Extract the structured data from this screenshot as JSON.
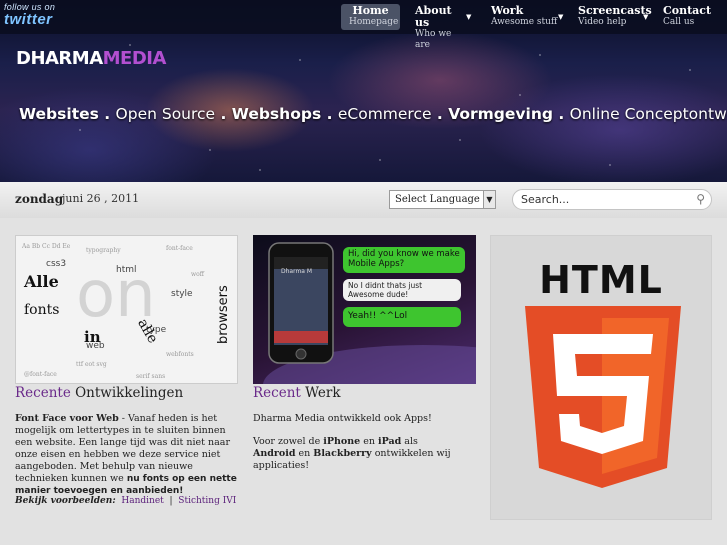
{
  "twitter": {
    "follow": "follow us on",
    "brand": "twitter"
  },
  "nav": [
    {
      "title": "Home",
      "sub": "Homepage"
    },
    {
      "title": "About us",
      "sub": "Who we are"
    },
    {
      "title": "Work",
      "sub": "Awesome stuff"
    },
    {
      "title": "Screencasts",
      "sub": "Video help"
    },
    {
      "title": "Contact",
      "sub": "Call us"
    }
  ],
  "logo": {
    "part1": "DHARMA",
    "part2": "MEDIA"
  },
  "tagline": {
    "w1": "Websites",
    "sep1": " . ",
    "w2": "Open Source",
    "sep2": " . ",
    "w3": "Webshops",
    "sep3": " . ",
    "w4": "eCommerce",
    "sep4": " . ",
    "w5": "Vormgeving",
    "sep5": " . ",
    "w6": "Online Conceptontwikkeling"
  },
  "datebar": {
    "day": "zondag",
    "date": "juni 26 , 2011"
  },
  "language": {
    "selected": "Select Language"
  },
  "search": {
    "placeholder": "Search..."
  },
  "col1": {
    "title_hl": "Recente",
    "title_rest": " Ontwikkelingen",
    "text_bold": "Font Face voor Web",
    "text": " - Vanaf heden is het mogelijk om lettertypes in te sluiten binnen een website. Een lange tijd was dit niet naar onze eisen en hebben we deze service niet aangeboden. Met behulp van nieuwe technieken kunnen we ",
    "text_bold2": "nu fonts op een nette manier toevoegen en aanbieden!",
    "examples_label": "Bekijk voorbeelden:",
    "link1": "Handinet",
    "link_sep": "|",
    "link2": "Stichting IVI"
  },
  "col2": {
    "title_hl": "Recent",
    "title_rest": " Werk",
    "p1": "Dharma Media ontwikkeld ook Apps!",
    "p2_a": "Voor zowel de ",
    "p2_b": "iPhone",
    "p2_c": " en ",
    "p2_d": "iPad",
    "p2_e": " als ",
    "p2_f": "Android",
    "p2_g": " en ",
    "p2_h": "Blackberry",
    "p2_i": " ontwikkelen wij applicaties!"
  },
  "font_image": {
    "w1": "Alle",
    "w2": "fonts",
    "w3": "in",
    "w4": "alle",
    "w5": "browsers"
  },
  "app_image": {
    "bubble1": "Hi, did you know we make Mobile Apps?",
    "bubble2": "No I didnt thats just Awesome dude!",
    "bubble3": "Yeah!! ^^Lol",
    "phone_label": "Dharma M"
  },
  "html5": {
    "word": "HTML",
    "numeral": "5"
  },
  "colors": {
    "accent": "#6a2a8a",
    "html5_orange": "#e44d26",
    "html5_dark": "#f16529"
  }
}
